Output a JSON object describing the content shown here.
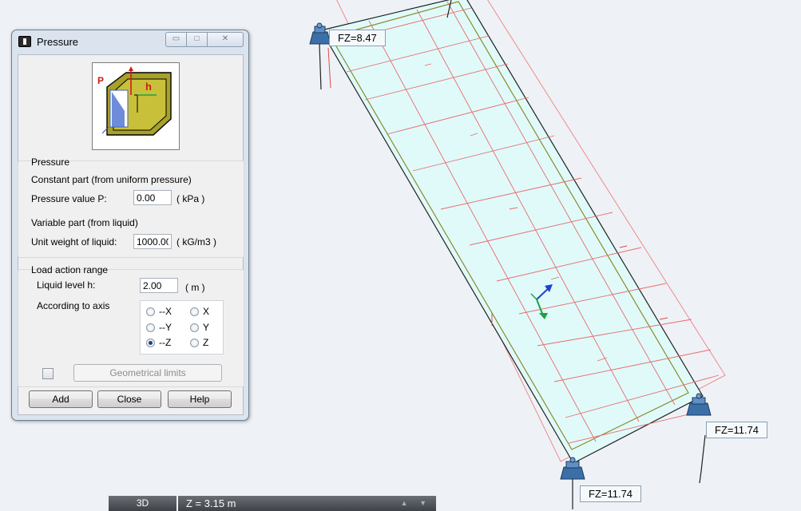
{
  "viewport": {
    "reaction_labels": [
      "FZ=8.47",
      "FZ=11.74",
      "FZ=11.74"
    ]
  },
  "dialog": {
    "title": "Pressure",
    "window_buttons": {
      "minimize": "▭",
      "maximize": "□",
      "close": "✕"
    },
    "diagram_labels": {
      "p": "P",
      "h": "h"
    },
    "pressure_group": {
      "title": "Pressure",
      "constant_label": "Constant part (from uniform pressure)",
      "pressure_value_label": "Pressure value P:",
      "pressure_value": "0.00",
      "pressure_unit": "( kPa )",
      "variable_label": "Variable part (from liquid)",
      "unit_weight_label": "Unit weight of liquid:",
      "unit_weight_value": "1000.00",
      "unit_weight_unit": "( kG/m3 )"
    },
    "range_group": {
      "title": "Load action range",
      "liquid_level_label": "Liquid level h:",
      "liquid_level_value": "2.00",
      "liquid_level_unit": "( m )",
      "axis_label": "According to axis",
      "axis_options": [
        "--X",
        "X",
        "--Y",
        "Y",
        "--Z",
        "Z"
      ],
      "selected_axis": "--Z"
    },
    "geometrical_limits_label": "Geometrical limits",
    "buttons": {
      "add": "Add",
      "close": "Close",
      "help": "Help"
    }
  },
  "status_bar": {
    "view_mode": "3D",
    "z_value": "Z = 3.15 m",
    "arrows": "▲ ▼"
  },
  "colors": {
    "background": "#eef2f6",
    "panel_fill": "#e0fafa",
    "mesh_red": "#e45858",
    "contour_olive": "#8c8a2c",
    "support_blue": "#3b6fa8",
    "axis_blue": "#2040d0",
    "axis_green": "#20a040"
  }
}
